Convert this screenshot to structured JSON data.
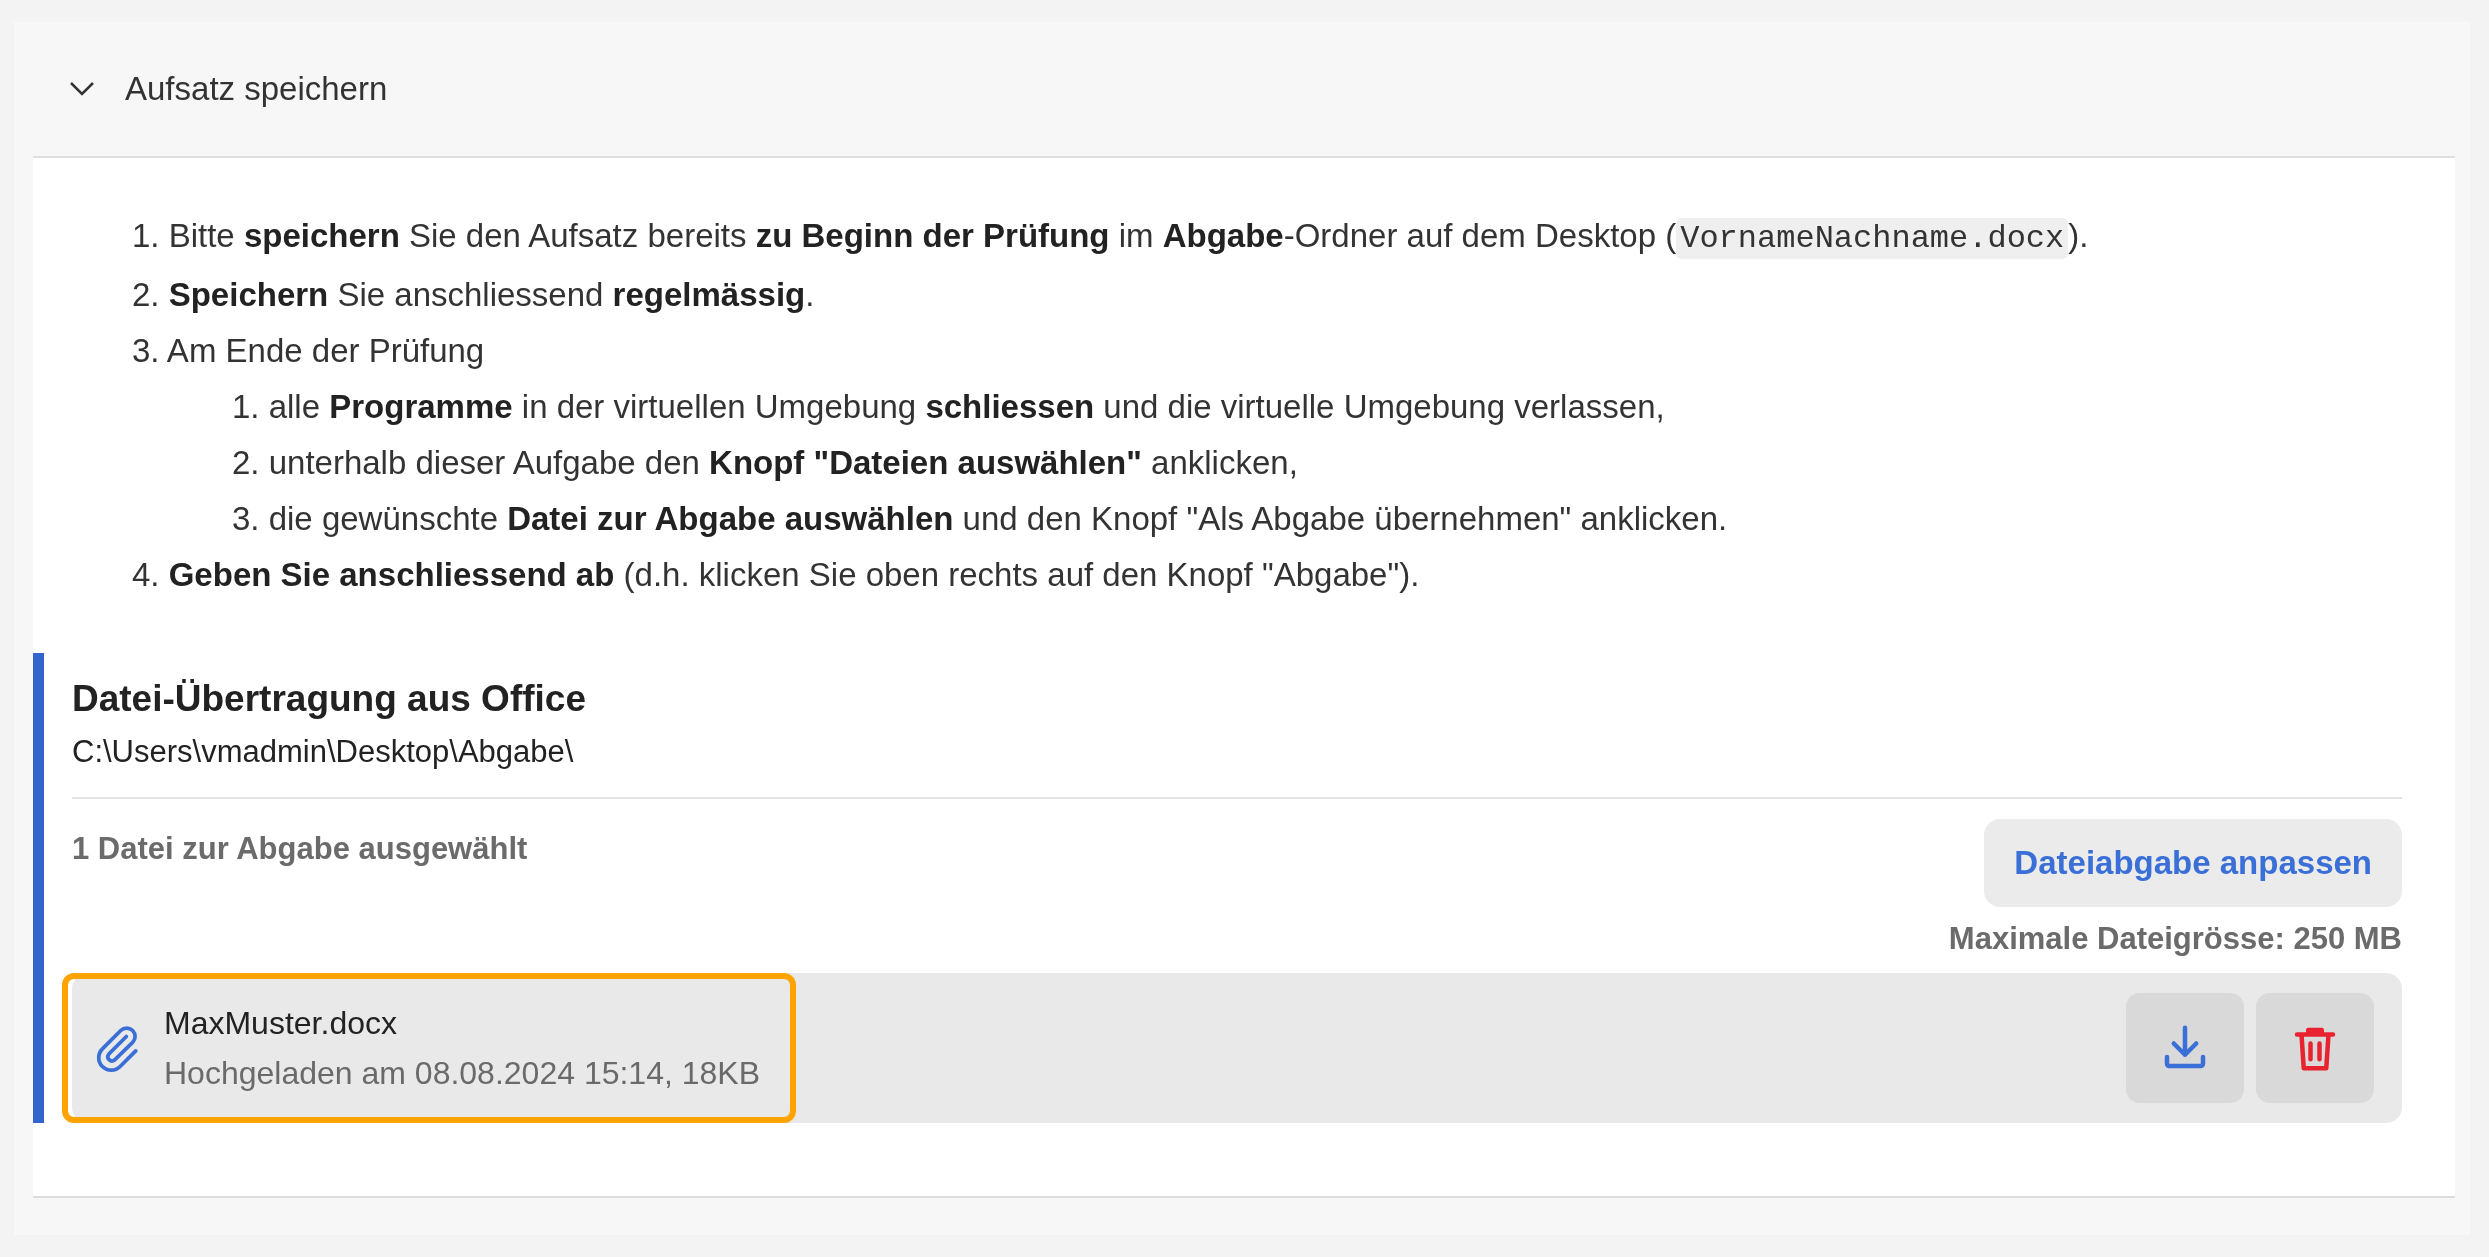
{
  "section": {
    "title": "Aufsatz speichern",
    "expanded": true
  },
  "instructions": [
    {
      "number": "1.",
      "parts": [
        {
          "kind": "text",
          "text": "Bitte **speichern** Sie den Aufsatz bereits **zu Beginn der Prüfung** im **Abgabe**-Ordner auf dem Desktop ("
        },
        {
          "kind": "code",
          "text": "VornameNachname.docx"
        },
        {
          "kind": "text",
          "text": ")."
        }
      ]
    },
    {
      "number": "2.",
      "parts": [
        {
          "kind": "text",
          "text": "**Speichern** Sie anschliessend **regelmässig**."
        }
      ]
    },
    {
      "number": "3.",
      "parts": [
        {
          "kind": "text",
          "text": "Am Ende der Prüfung"
        }
      ],
      "children": [
        {
          "number": "1.",
          "parts": [
            {
              "kind": "text",
              "text": "alle **Programme** in der virtuellen Umgebung **schliessen** und die virtuelle Umgebung verlassen,"
            }
          ]
        },
        {
          "number": "2.",
          "parts": [
            {
              "kind": "text",
              "text": "unterhalb dieser Aufgabe den **Knopf \"Dateien auswählen\"** anklicken,"
            }
          ]
        },
        {
          "number": "3.",
          "parts": [
            {
              "kind": "text",
              "text": "die gewünschte **Datei zur Abgabe auswählen** und den Knopf \"Als Abgabe übernehmen\" anklicken."
            }
          ]
        }
      ]
    },
    {
      "number": "4.",
      "parts": [
        {
          "kind": "text",
          "text": "**Geben Sie anschliessend ab** (d.h. klicken Sie oben rechts auf den Knopf \"Abgabe\")."
        }
      ]
    }
  ],
  "upload": {
    "title": "Datei-Übertragung aus Office",
    "path": "C:\\Users\\vmadmin\\Desktop\\Abgabe\\",
    "selected_count": "1 Datei zur Abgabe ausgewählt",
    "button": "Dateiabgabe anpassen",
    "max_size": "Maximale Dateigrösse: 250 MB",
    "files": [
      {
        "name": "MaxMuster.docx",
        "meta": "Hochgeladen am 08.08.2024 15:14, 18KB",
        "focused": true
      }
    ]
  }
}
